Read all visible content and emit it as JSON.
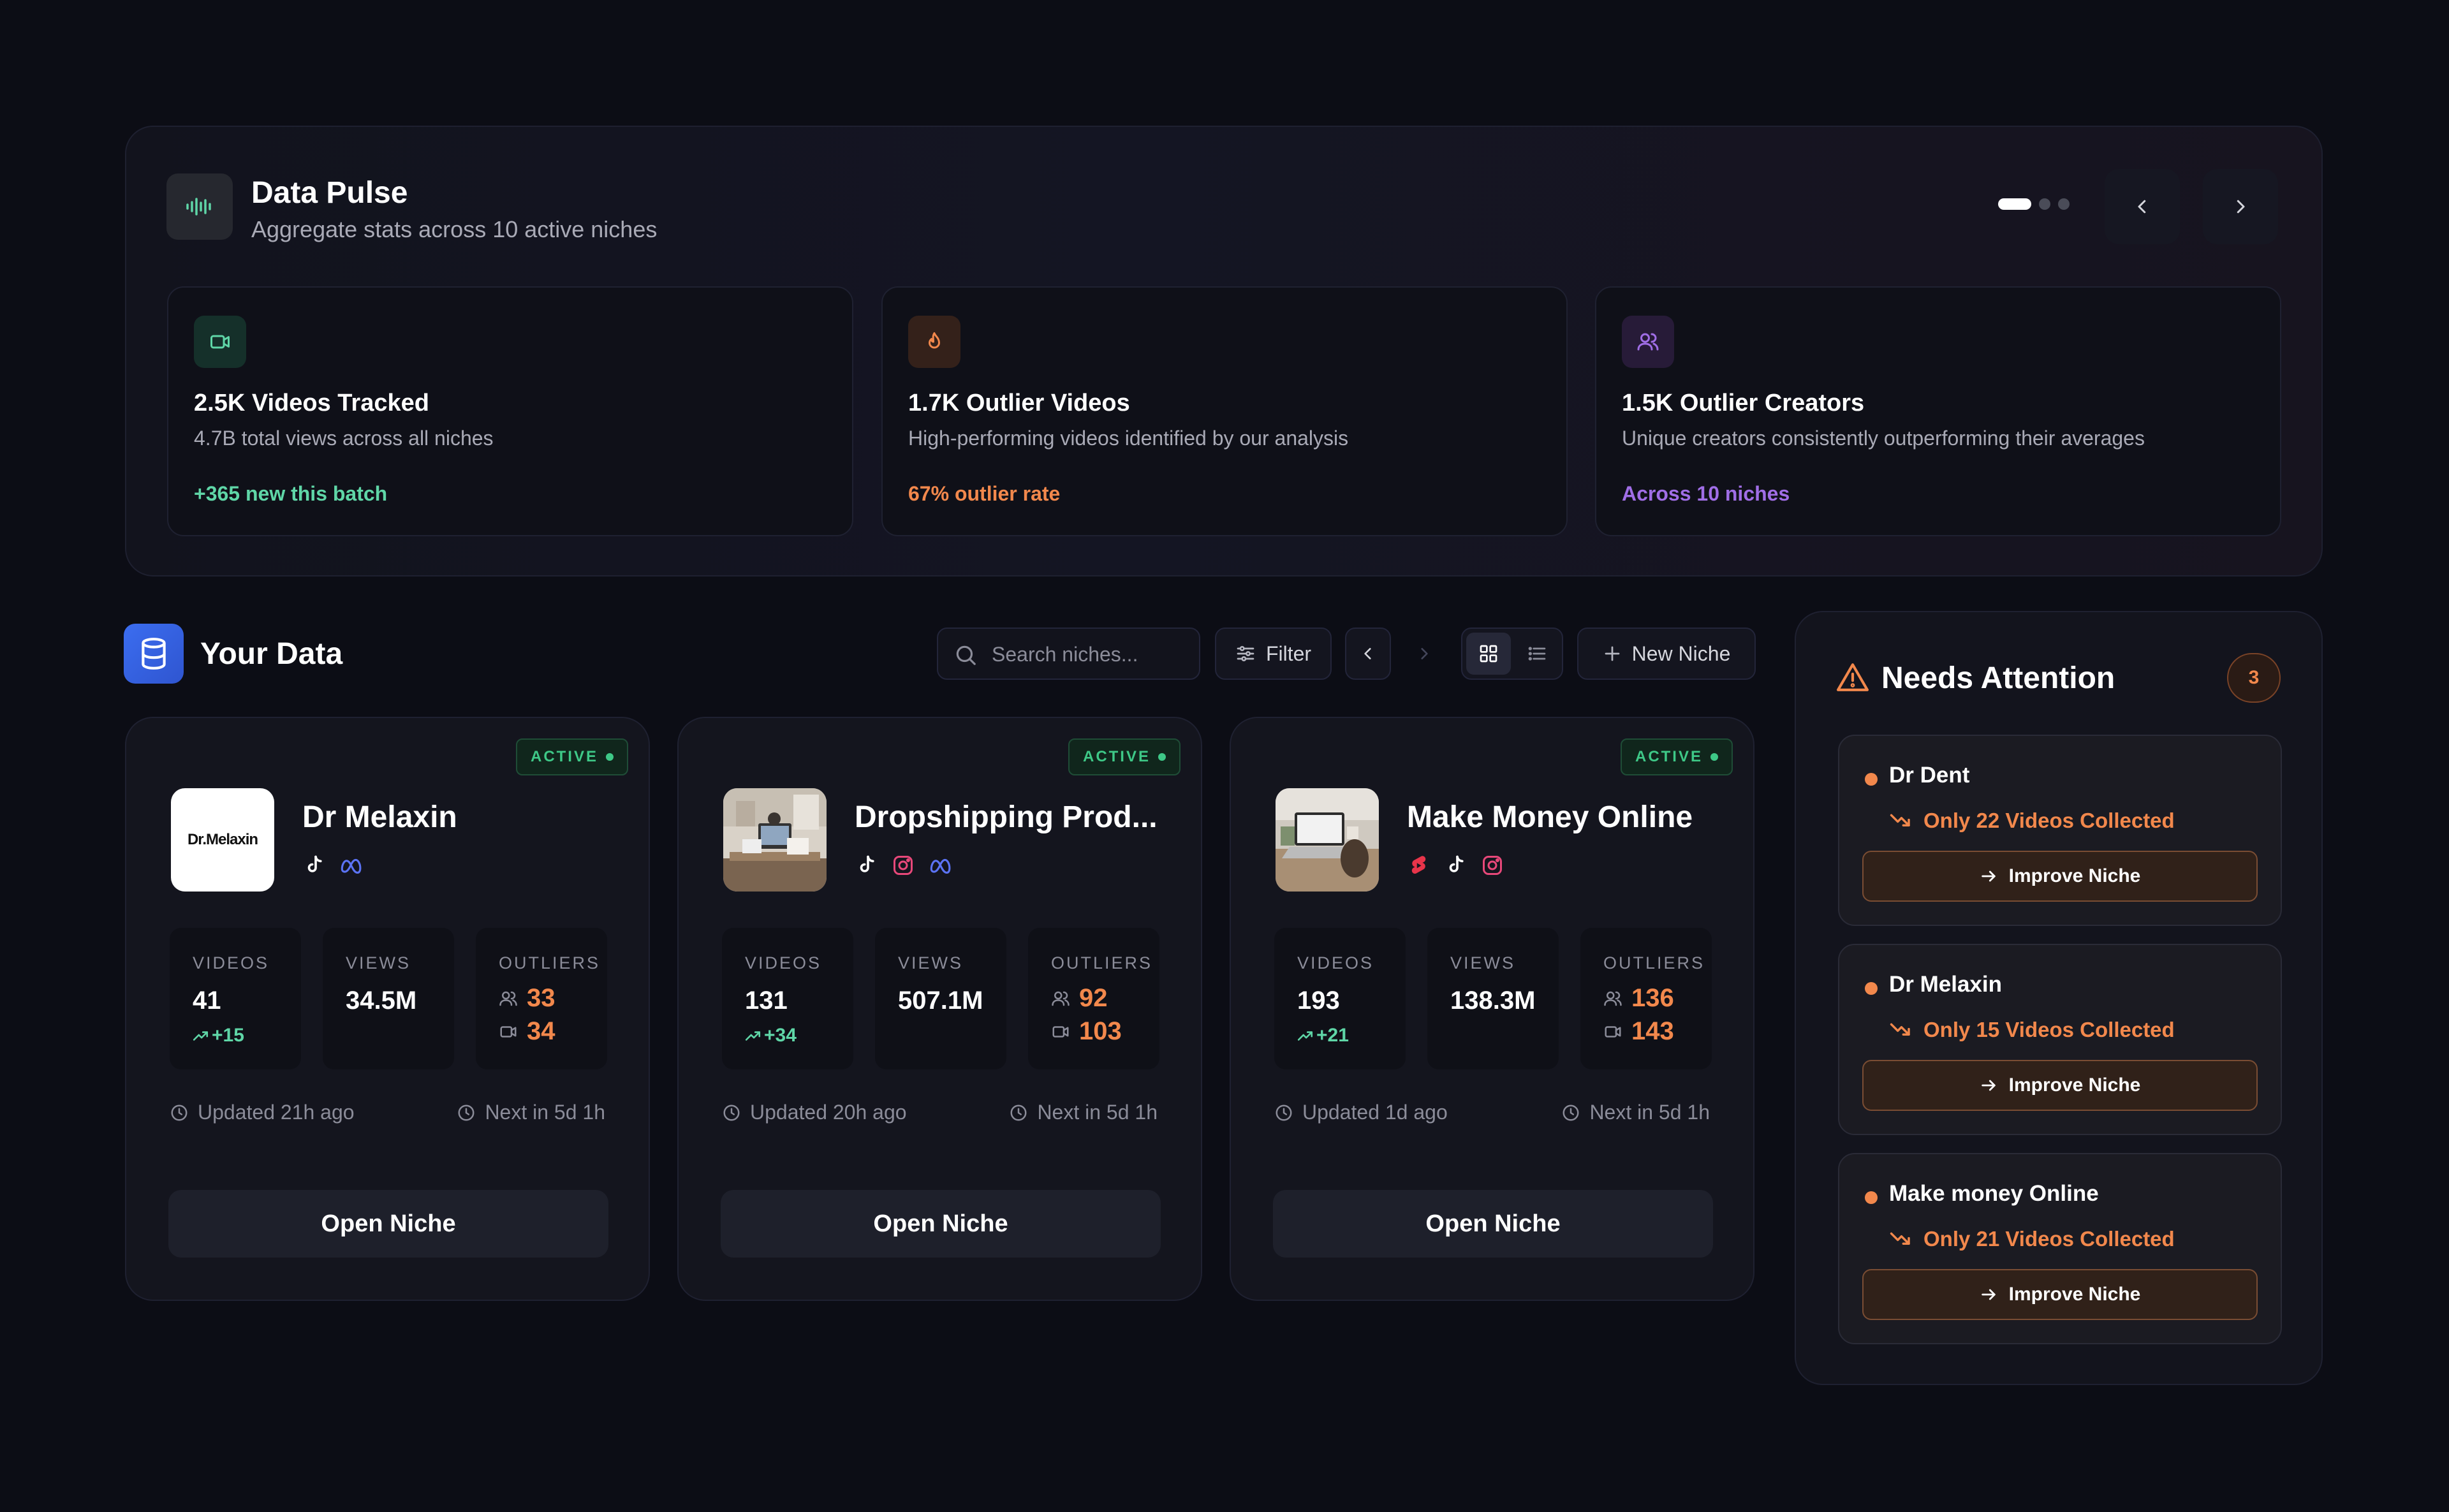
{
  "pulse": {
    "title": "Data Pulse",
    "subtitle": "Aggregate stats across 10 active niches",
    "pager": {
      "pages": 3,
      "active": 1
    },
    "cards": [
      {
        "icon": "video-icon",
        "title": "2.5K Videos Tracked",
        "desc": "4.7B total views across all niches",
        "stat": "+365 new this batch",
        "color": "#5fd6a7"
      },
      {
        "icon": "flame-icon",
        "title": "1.7K Outlier Videos",
        "desc": "High-performing videos identified by our analysis",
        "stat": "67% outlier rate",
        "color": "#f2884c"
      },
      {
        "icon": "users-icon",
        "title": "1.5K Outlier Creators",
        "desc": "Unique creators consistently outperforming their averages",
        "stat": "Across 10 niches",
        "color": "#a06ee6"
      }
    ]
  },
  "your_data": {
    "title": "Your Data",
    "search_placeholder": "Search niches...",
    "filter_label": "Filter",
    "new_niche_label": "New Niche"
  },
  "niches": [
    {
      "name": "Dr Melaxin",
      "logo_text": "Dr.Melaxin",
      "status": "ACTIVE",
      "platforms": [
        "tiktok-icon",
        "meta-icon"
      ],
      "labels": {
        "videos": "VIDEOS",
        "views": "VIEWS",
        "outliers": "OUTLIERS"
      },
      "videos": "41",
      "videos_trend": "+15",
      "views": "34.5M",
      "outlier_creators": "33",
      "outlier_videos": "34",
      "updated": "Updated 21h ago",
      "next": "Next in 5d 1h",
      "button": "Open Niche"
    },
    {
      "name": "Dropshipping Prod...",
      "status": "ACTIVE",
      "platforms": [
        "tiktok-icon",
        "instagram-icon",
        "meta-icon"
      ],
      "labels": {
        "videos": "VIDEOS",
        "views": "VIEWS",
        "outliers": "OUTLIERS"
      },
      "videos": "131",
      "videos_trend": "+34",
      "views": "507.1M",
      "outlier_creators": "92",
      "outlier_videos": "103",
      "updated": "Updated 20h ago",
      "next": "Next in 5d 1h",
      "button": "Open Niche"
    },
    {
      "name": "Make Money Online",
      "status": "ACTIVE",
      "platforms": [
        "youtube-shorts-icon",
        "tiktok-icon",
        "instagram-icon"
      ],
      "labels": {
        "videos": "VIDEOS",
        "views": "VIEWS",
        "outliers": "OUTLIERS"
      },
      "videos": "193",
      "videos_trend": "+21",
      "views": "138.3M",
      "outlier_creators": "136",
      "outlier_videos": "143",
      "updated": "Updated 1d ago",
      "next": "Next in 5d 1h",
      "button": "Open Niche"
    }
  ],
  "attention": {
    "title": "Needs Attention",
    "count": "3",
    "items": [
      {
        "name": "Dr Dent",
        "warning": "Only 22 Videos Collected",
        "button": "Improve Niche"
      },
      {
        "name": "Dr Melaxin",
        "warning": "Only 15 Videos Collected",
        "button": "Improve Niche"
      },
      {
        "name": "Make money Online",
        "warning": "Only 21 Videos Collected",
        "button": "Improve Niche"
      }
    ]
  },
  "colors": {
    "background": "#0c0d15",
    "accent_green": "#3ec887",
    "accent_orange": "#f2884c",
    "accent_purple": "#a06ee6",
    "accent_blue": "#3b6df0"
  }
}
